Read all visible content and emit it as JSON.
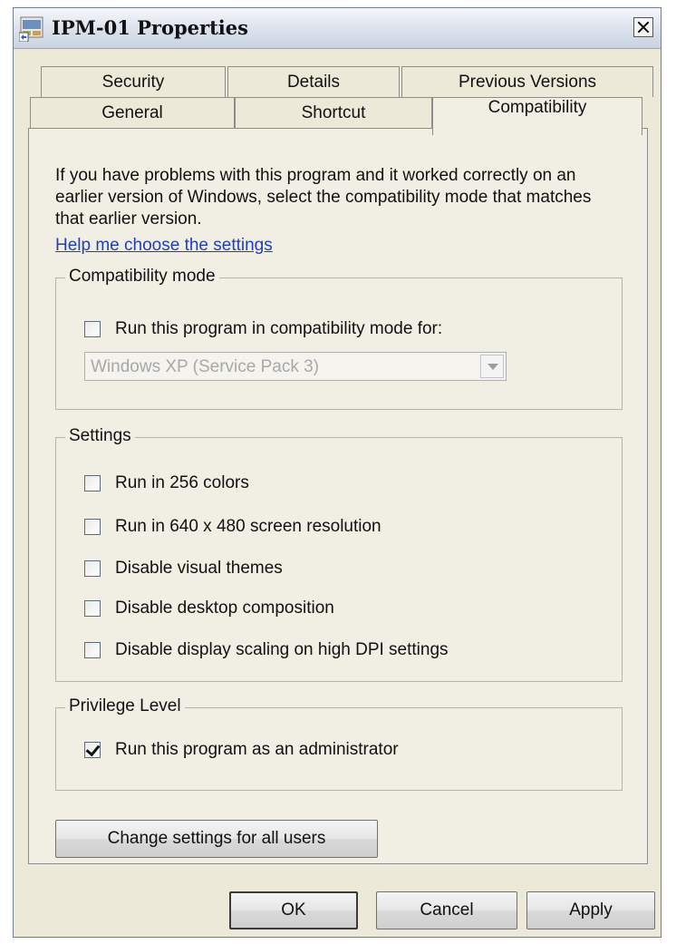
{
  "window": {
    "title": "IPM-01 Properties"
  },
  "tabs": {
    "back_row": [
      "Security",
      "Details",
      "Previous Versions"
    ],
    "front_row": [
      "General",
      "Shortcut",
      "Compatibility"
    ],
    "active": "Compatibility"
  },
  "intro": {
    "text": "If you have problems with this program and it worked correctly on an earlier version of Windows, select the compatibility mode that matches that earlier version.",
    "link": "Help me choose the settings"
  },
  "compat_mode": {
    "title": "Compatibility mode",
    "checkbox_label": "Run this program in compatibility mode for:",
    "checked": false,
    "selected_os": "Windows XP (Service Pack 3)"
  },
  "settings": {
    "title": "Settings",
    "options": [
      {
        "label": "Run in 256 colors",
        "checked": false
      },
      {
        "label": "Run in 640 x 480 screen resolution",
        "checked": false
      },
      {
        "label": "Disable visual themes",
        "checked": false
      },
      {
        "label": "Disable desktop composition",
        "checked": false
      },
      {
        "label": "Disable display scaling on high DPI settings",
        "checked": false
      }
    ]
  },
  "privilege": {
    "title": "Privilege Level",
    "label": "Run this program as an administrator",
    "checked": true
  },
  "buttons": {
    "change_all_users": "Change settings for all users",
    "ok": "OK",
    "cancel": "Cancel",
    "apply": "Apply"
  }
}
